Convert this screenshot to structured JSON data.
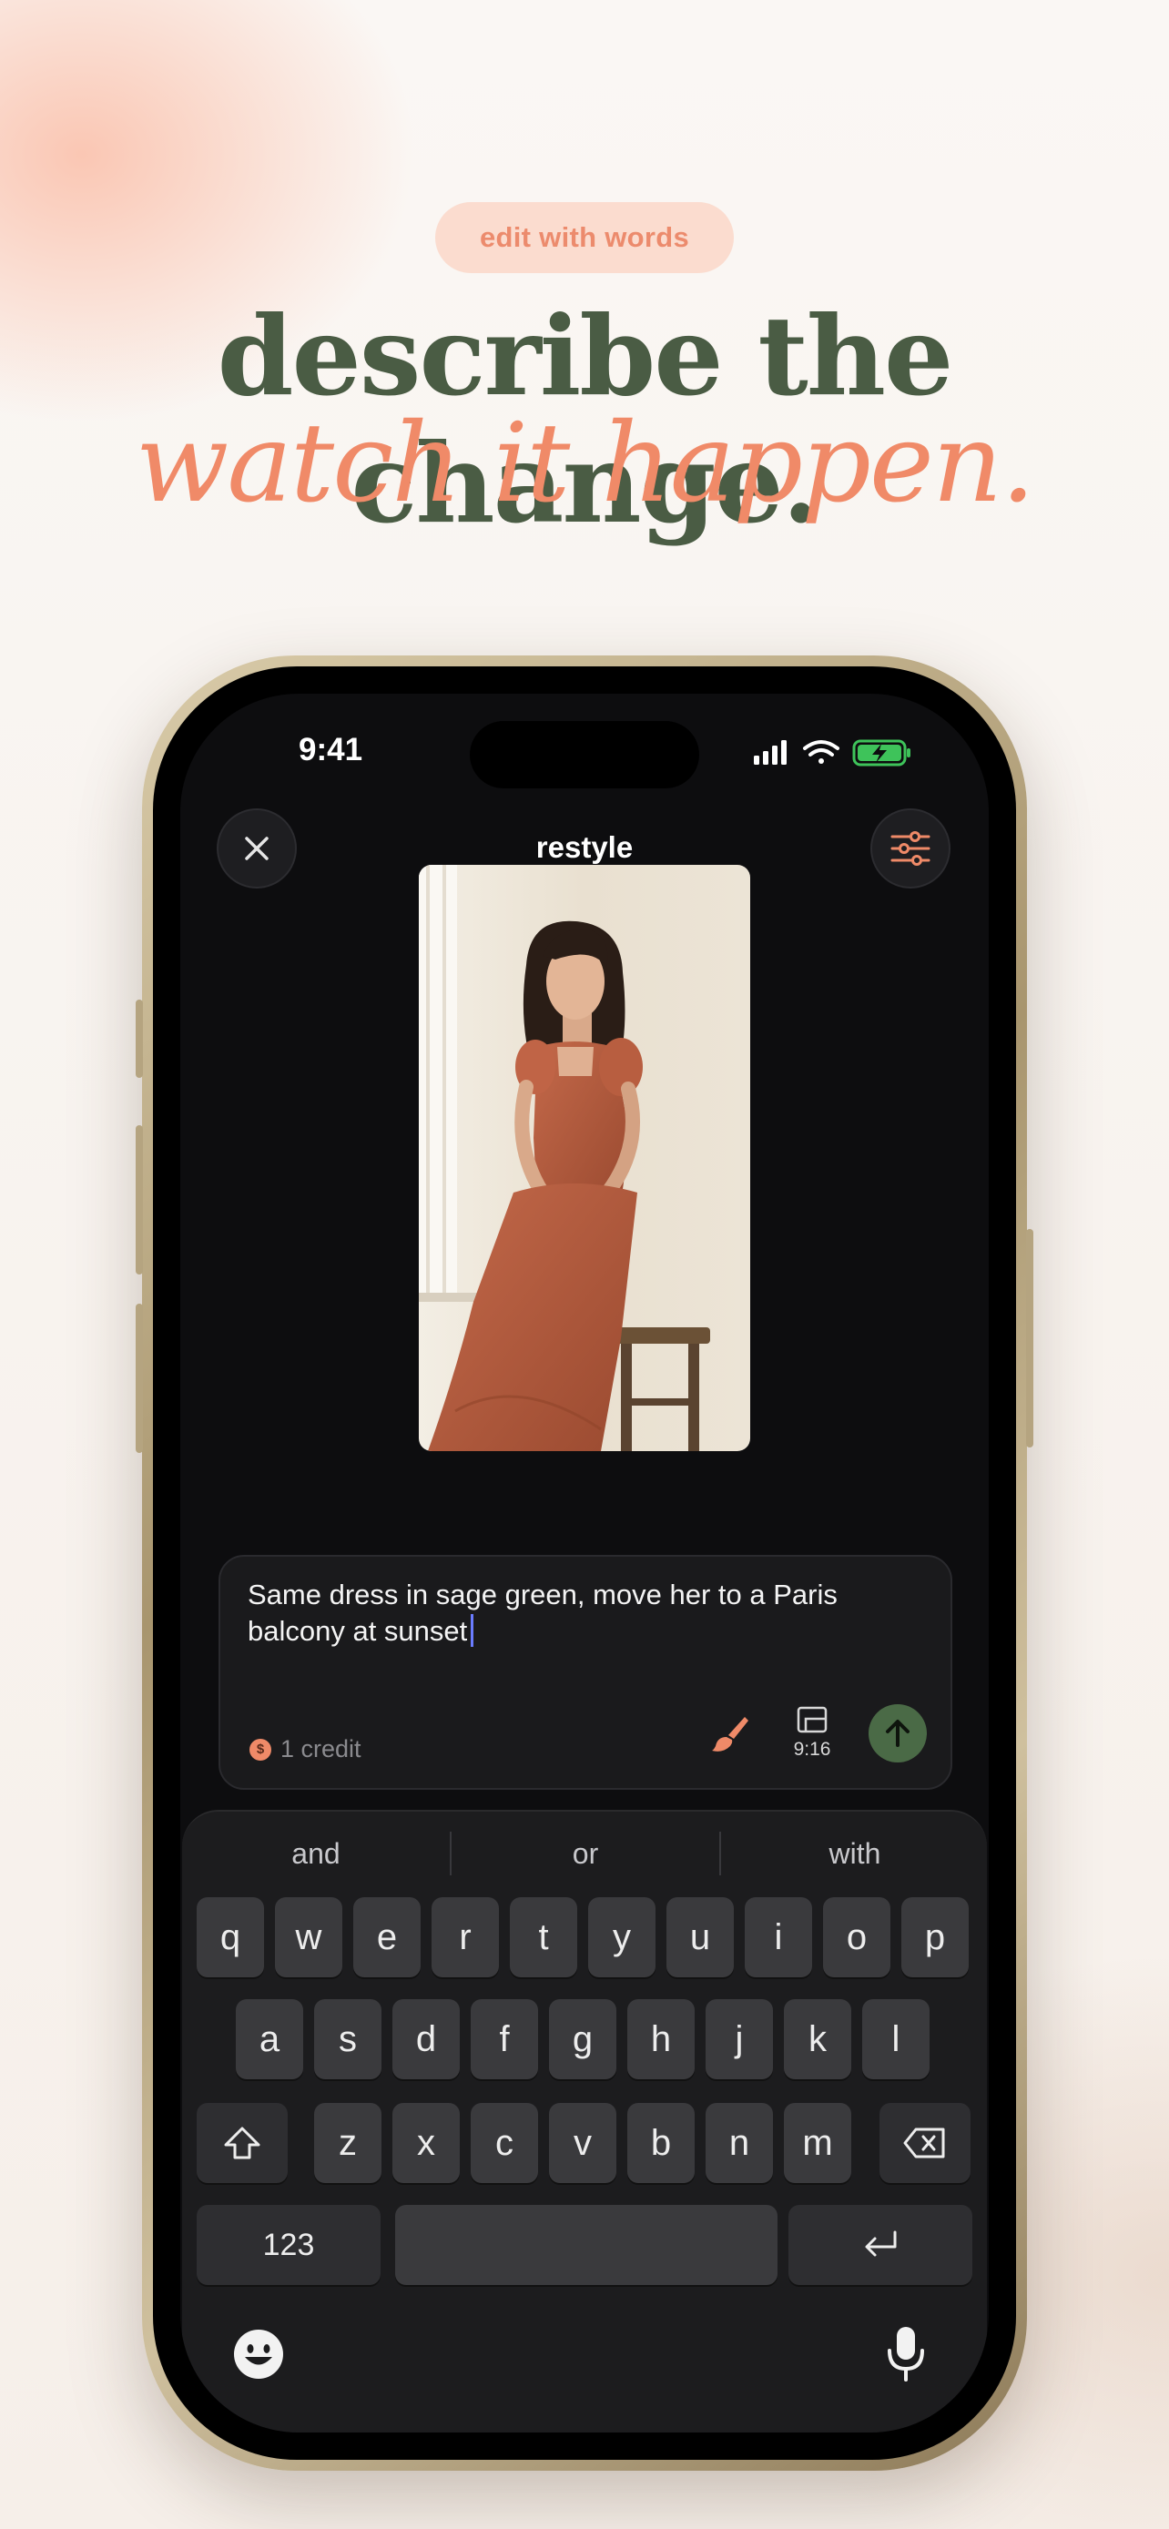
{
  "header": {
    "pill_label": "edit with words",
    "headline_line1": "describe the change.",
    "headline_line2": "watch it happen."
  },
  "status_bar": {
    "time": "9:41"
  },
  "editor": {
    "title": "restyle",
    "close_icon": "close-icon",
    "settings_icon": "sliders-icon",
    "photo_description_icon": "portrait-photo"
  },
  "composer": {
    "prompt_text": "Same dress in sage green, move her to a Paris balcony at sunset",
    "credit_label": "1 credit",
    "ratio_label": "9:16",
    "send_icon": "arrow-up-icon",
    "brush_icon": "brush-icon"
  },
  "keyboard": {
    "suggestions": [
      "and",
      "or",
      "with"
    ],
    "row1": [
      "q",
      "w",
      "e",
      "r",
      "t",
      "y",
      "u",
      "i",
      "o",
      "p"
    ],
    "row2": [
      "a",
      "s",
      "d",
      "f",
      "g",
      "h",
      "j",
      "k",
      "l"
    ],
    "row3": [
      "z",
      "x",
      "c",
      "v",
      "b",
      "n",
      "m"
    ],
    "numbers_label": "123"
  },
  "colors": {
    "accent_coral": "#f08a68",
    "sage_green": "#4a5c44",
    "send_button": "#4a6a46"
  }
}
